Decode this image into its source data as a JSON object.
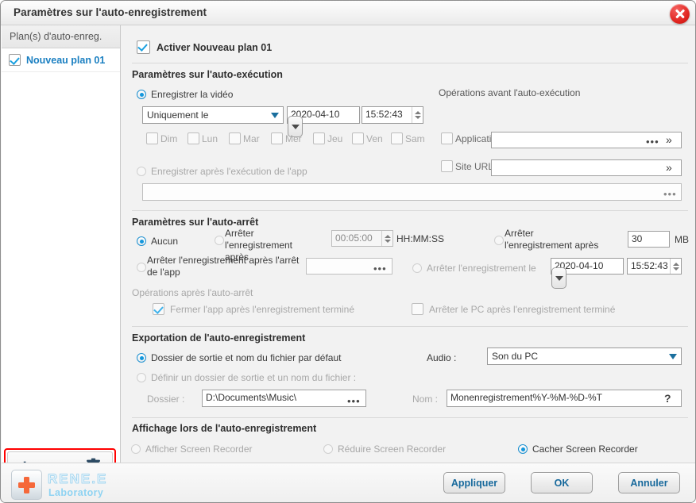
{
  "window": {
    "title": "Paramètres sur l'auto-enregistrement",
    "close_icon": "close-icon"
  },
  "sidebar": {
    "header": "Plan(s) d'auto-enreg.",
    "plans": [
      {
        "label": "Nouveau plan 01",
        "checked": true
      }
    ],
    "toolbar": {
      "add": "+",
      "remove": "–",
      "delete_icon": "trash-icon"
    }
  },
  "main": {
    "enable": {
      "label": "Activer Nouveau plan 01",
      "checked": true
    },
    "auto_exec": {
      "title": "Paramètres sur l'auto-exécution",
      "record_video_label": "Enregistrer la vidéo",
      "record_video_selected": true,
      "frequency_value": "Uniquement le",
      "date_value": "2020-04-10",
      "time_value": "15:52:43",
      "days": [
        "Dim",
        "Lun",
        "Mar",
        "Mer",
        "Jeu",
        "Ven",
        "Sam"
      ],
      "record_after_app_label": "Enregistrer après l'exécution de l'app",
      "record_after_app_selected": false,
      "app_path_value": "",
      "app_path_dots": "•••",
      "pre_ops_title": "Opérations avant l'auto-exécution",
      "pre_ops": [
        {
          "label": "Application",
          "checked": false,
          "value": "",
          "dots": "•••",
          "chevron": "»"
        },
        {
          "label": "Site URL",
          "checked": false,
          "value": "",
          "chevron": "»"
        }
      ]
    },
    "auto_stop": {
      "title": "Paramètres sur l'auto-arrêt",
      "none_label": "Aucun",
      "none_selected": true,
      "stop_after_duration_label": "Arrêter l'enregistrement après",
      "stop_after_duration_selected": false,
      "duration_value": "00:05:00",
      "duration_format": "HH:MM:SS",
      "stop_after_size_label": "Arrêter l'enregistrement après",
      "stop_after_size_selected": false,
      "size_value": "30",
      "size_unit": "MB",
      "stop_after_app_label": "Arrêter l'enregistrement après l'arrêt de l'app",
      "stop_after_app_selected": false,
      "app_value": "",
      "app_dots": "•••",
      "stop_at_datetime_label": "Arrêter l'enregistrement le",
      "stop_at_datetime_selected": false,
      "stop_date_value": "2020-04-10",
      "stop_time_value": "15:52:43",
      "post_ops_title": "Opérations après l'auto-arrêt",
      "post_ops": [
        {
          "label": "Fermer l'app après l'enregistrement terminé",
          "checked": true
        },
        {
          "label": "Arrêter le PC après l'enregistrement terminé",
          "checked": false
        }
      ]
    },
    "export": {
      "title": "Exportation de l'auto-enregistrement",
      "default_label": "Dossier de sortie et nom du fichier par défaut",
      "default_selected": true,
      "custom_label": "Définir un dossier de sortie et un nom du fichier :",
      "custom_selected": false,
      "folder_label": "Dossier :",
      "folder_value": "D:\\Documents\\Music\\",
      "folder_dots": "•••",
      "audio_label": "Audio :",
      "audio_value": "Son du PC",
      "name_label": "Nom :",
      "name_value": "Monenregistrement%Y-%M-%D-%T",
      "name_help": "?"
    },
    "display": {
      "title": "Affichage lors de l'auto-enregistrement",
      "options": [
        {
          "label": "Afficher Screen Recorder",
          "selected": false,
          "disabled": true
        },
        {
          "label": "Réduire Screen Recorder",
          "selected": false,
          "disabled": true
        },
        {
          "label": "Cacher Screen Recorder",
          "selected": true,
          "disabled": false
        }
      ]
    }
  },
  "footer": {
    "logo_name": "RENE.E",
    "logo_sub": "Laboratory",
    "buttons": [
      {
        "label": "Appliquer"
      },
      {
        "label": "OK"
      },
      {
        "label": "Annuler"
      }
    ]
  },
  "colors": {
    "accent_blue": "#1397dd",
    "link_blue": "#1a7fc1",
    "highlight_red": "#ff0000",
    "logo_orange": "#f5683a"
  }
}
